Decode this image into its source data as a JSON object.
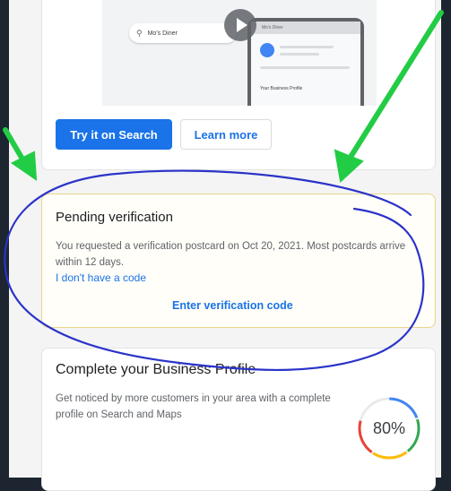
{
  "preview": {
    "search_text": "Mo's Diner",
    "phone_title": "Mo's Diner",
    "phone_item": "Your Business Profile"
  },
  "buttons": {
    "try_search": "Try it on Search",
    "learn_more": "Learn more"
  },
  "pending": {
    "title": "Pending verification",
    "body": "You requested a verification postcard on Oct 20, 2021. Most postcards arrive within 12 days.",
    "link": "I don't have a code",
    "action": "Enter verification code"
  },
  "complete": {
    "title": "Complete your Business Profile",
    "body": "Get noticed by more customers in your area with a complete profile on Search and Maps",
    "progress_label": "80%",
    "progress_value": 0.8
  },
  "colors": {
    "accent": "#1a73e8",
    "annotation_arrow": "#22cc44",
    "annotation_circle": "#2b33c9"
  }
}
